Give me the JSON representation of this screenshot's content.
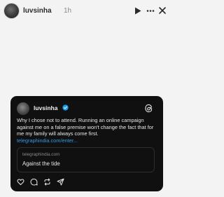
{
  "story": {
    "username": "luvsinha",
    "time": "1h",
    "icons": {
      "play": "play-icon",
      "more": "more-icon",
      "close": "close-icon"
    }
  },
  "post": {
    "username": "luvsinha",
    "verified_icon": "verified-badge-icon",
    "platform_icon": "threads-icon",
    "text": "Why I chose not to attend. Running an online campaign against me on a false premise won't change the fact that for me my family will always come first. ",
    "link_text": "telegraphindia.com/enter...",
    "link_preview": {
      "domain": "telegraphindia.com",
      "title": "Against the tide"
    },
    "actions": [
      "heart-icon",
      "comment-icon",
      "repost-icon",
      "share-icon"
    ]
  },
  "colors": {
    "background": "#f3f3f3",
    "card": "#101010",
    "link": "#2f9ae6",
    "verified": "#1d9bf0"
  }
}
